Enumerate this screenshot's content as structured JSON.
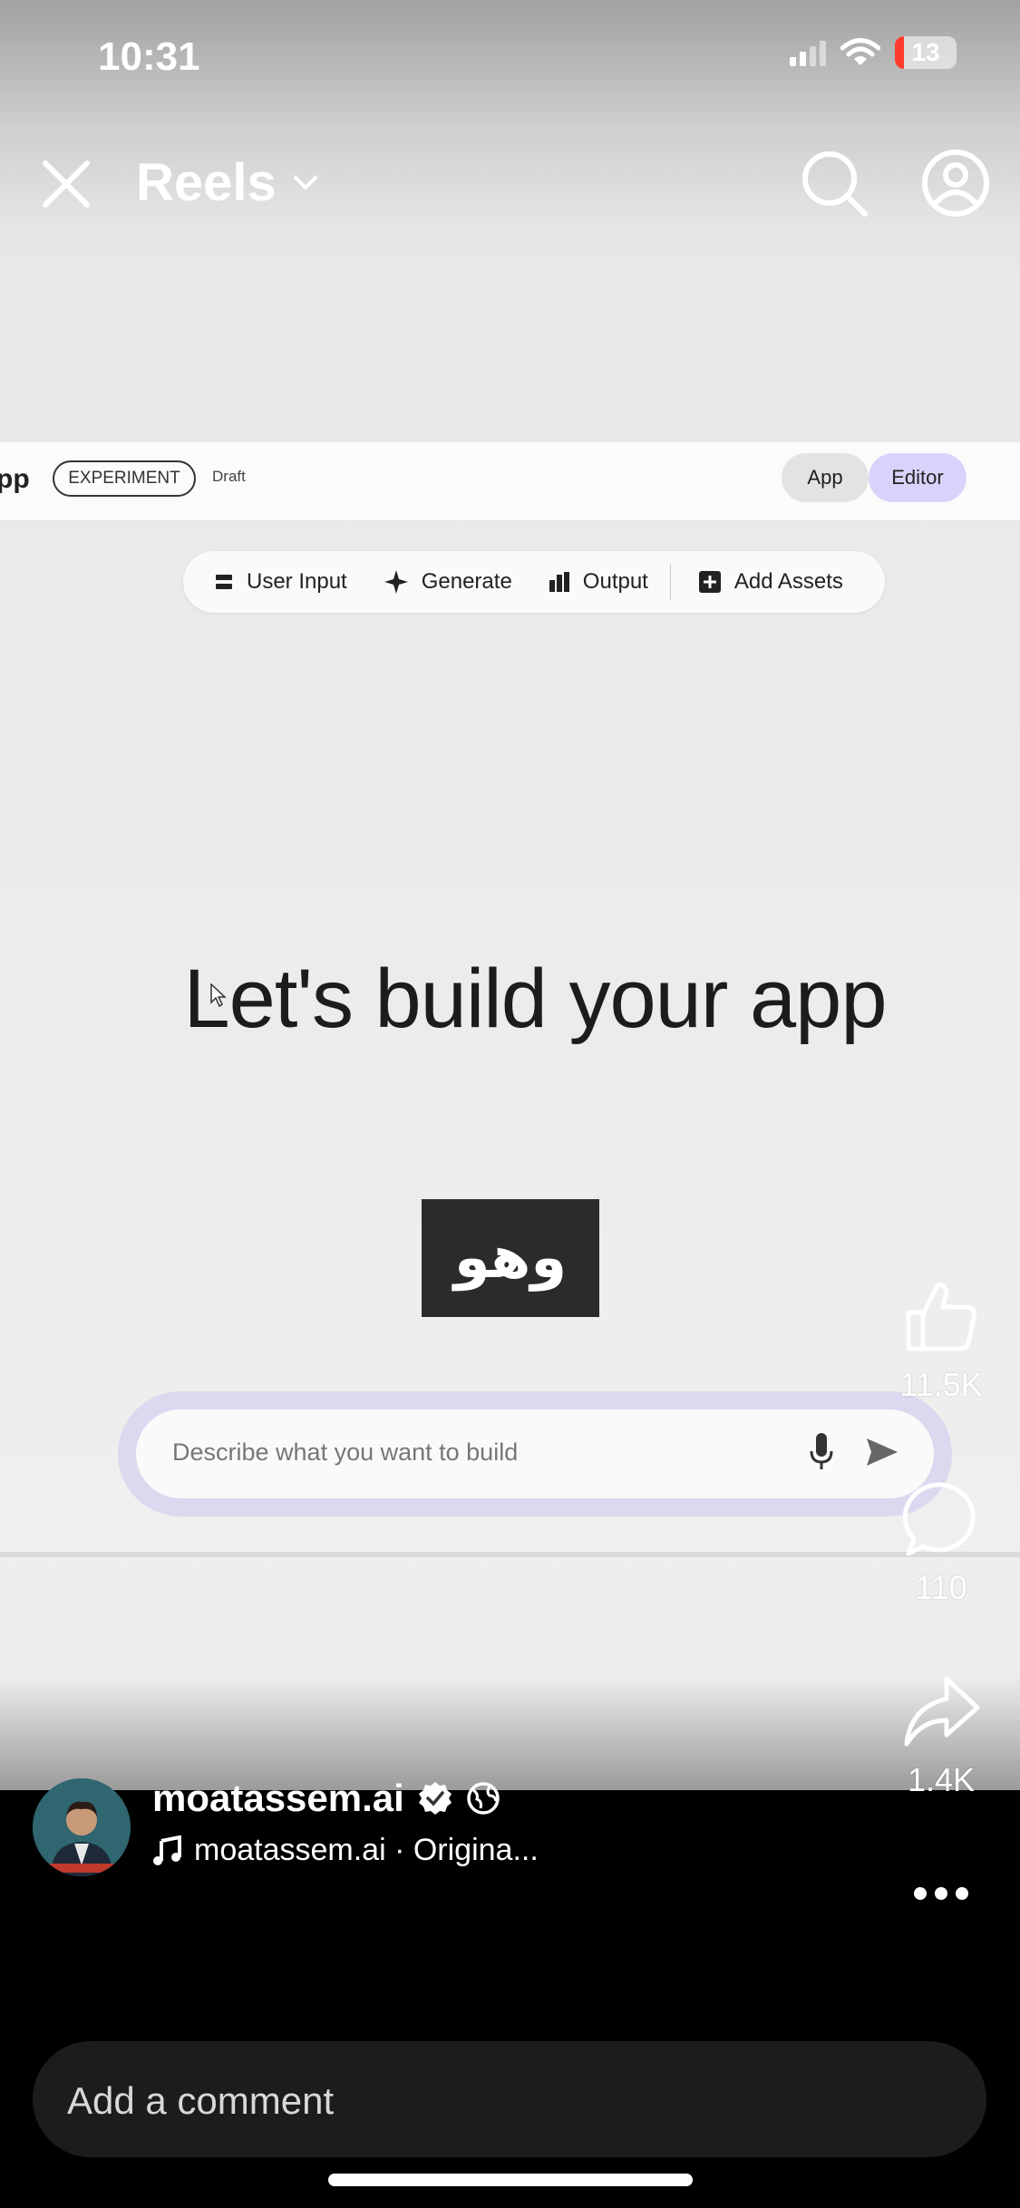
{
  "status_bar": {
    "time": "10:31",
    "battery": "13"
  },
  "header": {
    "title": "Reels"
  },
  "embedded_app": {
    "app_name": "pp",
    "badge": "EXPERIMENT",
    "status": "Draft",
    "view_toggle": {
      "app": "App",
      "editor": "Editor"
    },
    "toolbar": [
      "User Input",
      "Generate",
      "Output",
      "Add Assets"
    ],
    "headline": "Let's build your app",
    "caption": "وهو",
    "prompt_placeholder": "Describe what you want to build"
  },
  "actions": {
    "likes": "11.5K",
    "comments": "110",
    "shares": "1.4K"
  },
  "author": {
    "username": "moatassem.ai",
    "audio": "moatassem.ai · Origina..."
  },
  "comment_bar": {
    "placeholder": "Add a comment"
  },
  "colors": {
    "editor_accent": "#d9d3fb",
    "battery_low": "#ff3b30"
  }
}
